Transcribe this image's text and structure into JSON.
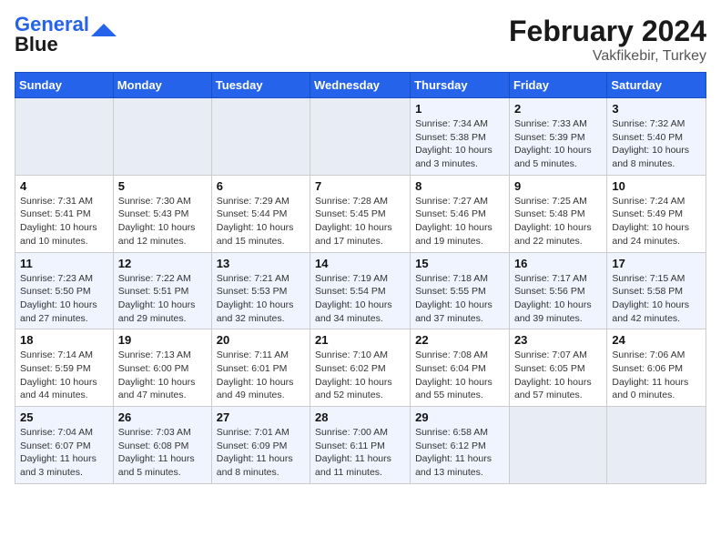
{
  "header": {
    "logo_line1": "General",
    "logo_line2": "Blue",
    "main_title": "February 2024",
    "subtitle": "Vakfikebir, Turkey"
  },
  "columns": [
    "Sunday",
    "Monday",
    "Tuesday",
    "Wednesday",
    "Thursday",
    "Friday",
    "Saturday"
  ],
  "weeks": [
    [
      {
        "num": "",
        "info": ""
      },
      {
        "num": "",
        "info": ""
      },
      {
        "num": "",
        "info": ""
      },
      {
        "num": "",
        "info": ""
      },
      {
        "num": "1",
        "info": "Sunrise: 7:34 AM\nSunset: 5:38 PM\nDaylight: 10 hours\nand 3 minutes."
      },
      {
        "num": "2",
        "info": "Sunrise: 7:33 AM\nSunset: 5:39 PM\nDaylight: 10 hours\nand 5 minutes."
      },
      {
        "num": "3",
        "info": "Sunrise: 7:32 AM\nSunset: 5:40 PM\nDaylight: 10 hours\nand 8 minutes."
      }
    ],
    [
      {
        "num": "4",
        "info": "Sunrise: 7:31 AM\nSunset: 5:41 PM\nDaylight: 10 hours\nand 10 minutes."
      },
      {
        "num": "5",
        "info": "Sunrise: 7:30 AM\nSunset: 5:43 PM\nDaylight: 10 hours\nand 12 minutes."
      },
      {
        "num": "6",
        "info": "Sunrise: 7:29 AM\nSunset: 5:44 PM\nDaylight: 10 hours\nand 15 minutes."
      },
      {
        "num": "7",
        "info": "Sunrise: 7:28 AM\nSunset: 5:45 PM\nDaylight: 10 hours\nand 17 minutes."
      },
      {
        "num": "8",
        "info": "Sunrise: 7:27 AM\nSunset: 5:46 PM\nDaylight: 10 hours\nand 19 minutes."
      },
      {
        "num": "9",
        "info": "Sunrise: 7:25 AM\nSunset: 5:48 PM\nDaylight: 10 hours\nand 22 minutes."
      },
      {
        "num": "10",
        "info": "Sunrise: 7:24 AM\nSunset: 5:49 PM\nDaylight: 10 hours\nand 24 minutes."
      }
    ],
    [
      {
        "num": "11",
        "info": "Sunrise: 7:23 AM\nSunset: 5:50 PM\nDaylight: 10 hours\nand 27 minutes."
      },
      {
        "num": "12",
        "info": "Sunrise: 7:22 AM\nSunset: 5:51 PM\nDaylight: 10 hours\nand 29 minutes."
      },
      {
        "num": "13",
        "info": "Sunrise: 7:21 AM\nSunset: 5:53 PM\nDaylight: 10 hours\nand 32 minutes."
      },
      {
        "num": "14",
        "info": "Sunrise: 7:19 AM\nSunset: 5:54 PM\nDaylight: 10 hours\nand 34 minutes."
      },
      {
        "num": "15",
        "info": "Sunrise: 7:18 AM\nSunset: 5:55 PM\nDaylight: 10 hours\nand 37 minutes."
      },
      {
        "num": "16",
        "info": "Sunrise: 7:17 AM\nSunset: 5:56 PM\nDaylight: 10 hours\nand 39 minutes."
      },
      {
        "num": "17",
        "info": "Sunrise: 7:15 AM\nSunset: 5:58 PM\nDaylight: 10 hours\nand 42 minutes."
      }
    ],
    [
      {
        "num": "18",
        "info": "Sunrise: 7:14 AM\nSunset: 5:59 PM\nDaylight: 10 hours\nand 44 minutes."
      },
      {
        "num": "19",
        "info": "Sunrise: 7:13 AM\nSunset: 6:00 PM\nDaylight: 10 hours\nand 47 minutes."
      },
      {
        "num": "20",
        "info": "Sunrise: 7:11 AM\nSunset: 6:01 PM\nDaylight: 10 hours\nand 49 minutes."
      },
      {
        "num": "21",
        "info": "Sunrise: 7:10 AM\nSunset: 6:02 PM\nDaylight: 10 hours\nand 52 minutes."
      },
      {
        "num": "22",
        "info": "Sunrise: 7:08 AM\nSunset: 6:04 PM\nDaylight: 10 hours\nand 55 minutes."
      },
      {
        "num": "23",
        "info": "Sunrise: 7:07 AM\nSunset: 6:05 PM\nDaylight: 10 hours\nand 57 minutes."
      },
      {
        "num": "24",
        "info": "Sunrise: 7:06 AM\nSunset: 6:06 PM\nDaylight: 11 hours\nand 0 minutes."
      }
    ],
    [
      {
        "num": "25",
        "info": "Sunrise: 7:04 AM\nSunset: 6:07 PM\nDaylight: 11 hours\nand 3 minutes."
      },
      {
        "num": "26",
        "info": "Sunrise: 7:03 AM\nSunset: 6:08 PM\nDaylight: 11 hours\nand 5 minutes."
      },
      {
        "num": "27",
        "info": "Sunrise: 7:01 AM\nSunset: 6:09 PM\nDaylight: 11 hours\nand 8 minutes."
      },
      {
        "num": "28",
        "info": "Sunrise: 7:00 AM\nSunset: 6:11 PM\nDaylight: 11 hours\nand 11 minutes."
      },
      {
        "num": "29",
        "info": "Sunrise: 6:58 AM\nSunset: 6:12 PM\nDaylight: 11 hours\nand 13 minutes."
      },
      {
        "num": "",
        "info": ""
      },
      {
        "num": "",
        "info": ""
      }
    ]
  ]
}
